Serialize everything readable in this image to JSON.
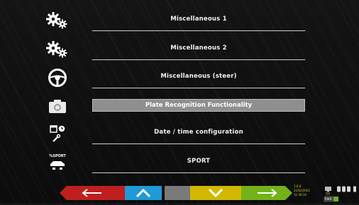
{
  "menu": {
    "items": [
      {
        "label": "Miscellaneous 1",
        "icon": "gears-icon"
      },
      {
        "label": "Miscellaneous 2",
        "icon": "gears-icon"
      },
      {
        "label": "Miscellaneous (steer)",
        "icon": "steering-wheel-icon"
      },
      {
        "label": "Plate Recognition Functionality",
        "icon": "camera-icon",
        "selected": true
      },
      {
        "label": "Date / time configuration",
        "icon": "calendar-clock-icon"
      },
      {
        "label": "SPORT",
        "icon": "sport-car-icon",
        "icon_text": "%SPORT"
      }
    ]
  },
  "toolbar": {
    "buttons": [
      {
        "name": "back",
        "icon": "arrow-left-icon",
        "color": "#c01f1f"
      },
      {
        "name": "up",
        "icon": "chevron-up-icon",
        "color": "#1f9ad6"
      },
      {
        "name": "blank",
        "color": "#7a7a7a"
      },
      {
        "name": "down",
        "icon": "chevron-down-icon",
        "color": "#d2b800"
      },
      {
        "name": "forward",
        "icon": "arrow-right-icon",
        "color": "#74b21c"
      }
    ]
  },
  "status": {
    "version": "1.0.0",
    "date": "22/02/2021",
    "time": "11:40:14",
    "units": "ITA",
    "mode": "RWD"
  }
}
